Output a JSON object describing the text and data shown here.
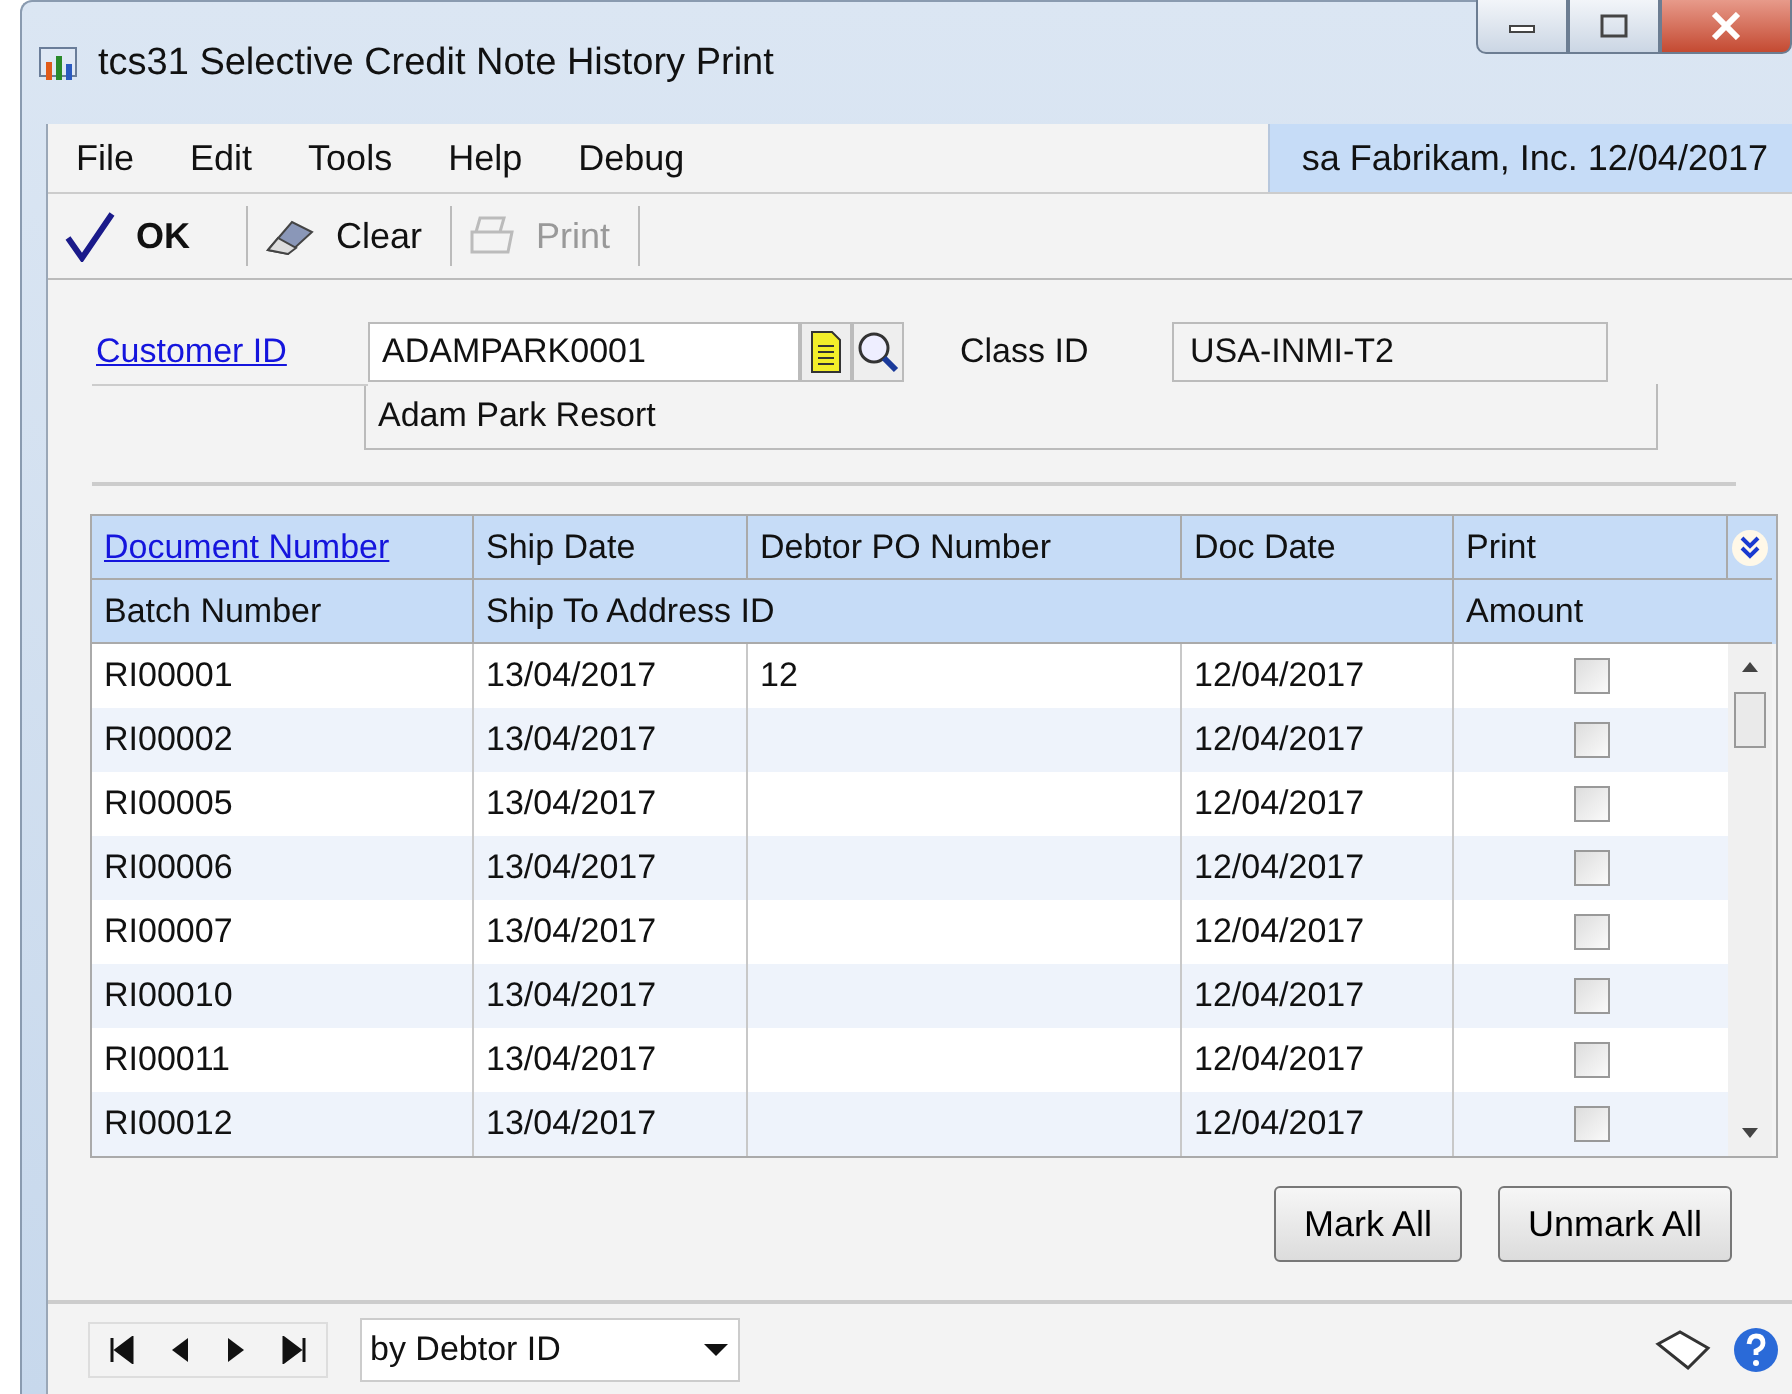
{
  "window": {
    "title": "tcs31 Selective Credit Note History Print"
  },
  "menu": [
    "File",
    "Edit",
    "Tools",
    "Help",
    "Debug"
  ],
  "session": "sa  Fabrikam, Inc.  12/04/2017",
  "toolbar": [
    {
      "kind": "ok",
      "label": "OK",
      "disabled": false
    },
    {
      "kind": "clear",
      "label": "Clear",
      "disabled": false
    },
    {
      "kind": "print",
      "label": "Print",
      "disabled": true
    }
  ],
  "customer": {
    "label": "Customer ID",
    "value": "ADAMPARK0001",
    "name": "Adam Park Resort",
    "class_label": "Class ID",
    "class_value": "USA-INMI-T2"
  },
  "table": {
    "header1": [
      "Document Number",
      "Ship Date",
      "Debtor PO Number",
      "Doc Date",
      "Print"
    ],
    "header2": [
      "Batch Number",
      "Ship To Address ID",
      "Amount"
    ],
    "rows": [
      {
        "doc": "RI00001",
        "ship": "13/04/2017",
        "po": "12",
        "date": "12/04/2017",
        "checked": false
      },
      {
        "doc": "RI00002",
        "ship": "13/04/2017",
        "po": "",
        "date": "12/04/2017",
        "checked": false
      },
      {
        "doc": "RI00005",
        "ship": "13/04/2017",
        "po": "",
        "date": "12/04/2017",
        "checked": false
      },
      {
        "doc": "RI00006",
        "ship": "13/04/2017",
        "po": "",
        "date": "12/04/2017",
        "checked": false
      },
      {
        "doc": "RI00007",
        "ship": "13/04/2017",
        "po": "",
        "date": "12/04/2017",
        "checked": false
      },
      {
        "doc": "RI00010",
        "ship": "13/04/2017",
        "po": "",
        "date": "12/04/2017",
        "checked": false
      },
      {
        "doc": "RI00011",
        "ship": "13/04/2017",
        "po": "",
        "date": "12/04/2017",
        "checked": false
      },
      {
        "doc": "RI00012",
        "ship": "13/04/2017",
        "po": "",
        "date": "12/04/2017",
        "checked": false
      }
    ]
  },
  "buttons": [
    "Mark All",
    "Unmark All"
  ],
  "sort": {
    "value": "by Debtor ID"
  }
}
